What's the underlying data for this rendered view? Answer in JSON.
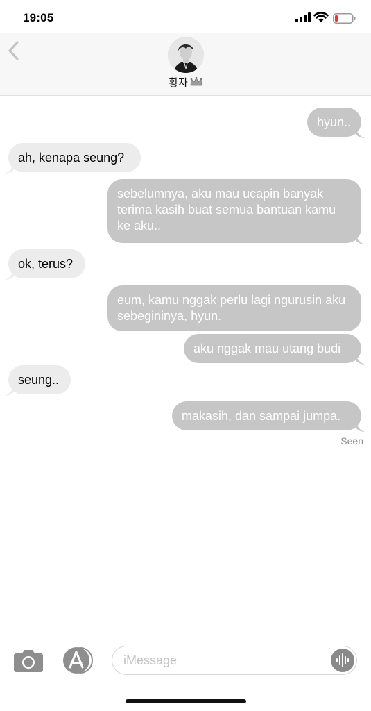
{
  "status_bar": {
    "time": "19:05"
  },
  "header": {
    "back_icon": "chevron-left-icon",
    "contact_name": "황자",
    "contact_emoji": "crown-icon"
  },
  "messages": [
    {
      "side": "sent",
      "text": "hyun.."
    },
    {
      "side": "received",
      "text": "ah, kenapa seung?"
    },
    {
      "side": "sent",
      "text": "sebelumnya, aku mau ucapin banyak terima kasih buat semua bantuan kamu ke aku.."
    },
    {
      "side": "received",
      "text": "ok, terus?"
    },
    {
      "side": "sent",
      "text": "eum, kamu nggak perlu lagi ngurusin aku sebegininya, hyun."
    },
    {
      "side": "sent",
      "text": "aku nggak mau utang budi"
    },
    {
      "side": "received",
      "text": "seung.."
    },
    {
      "side": "sent",
      "text": "makasih, dan sampai jumpa."
    }
  ],
  "seen_label": "Seen",
  "compose": {
    "placeholder": "iMessage",
    "value": ""
  },
  "colors": {
    "sent_bubble": "#c6c6c6",
    "received_bubble": "#ececec",
    "header_bg": "#f7f7f7"
  }
}
